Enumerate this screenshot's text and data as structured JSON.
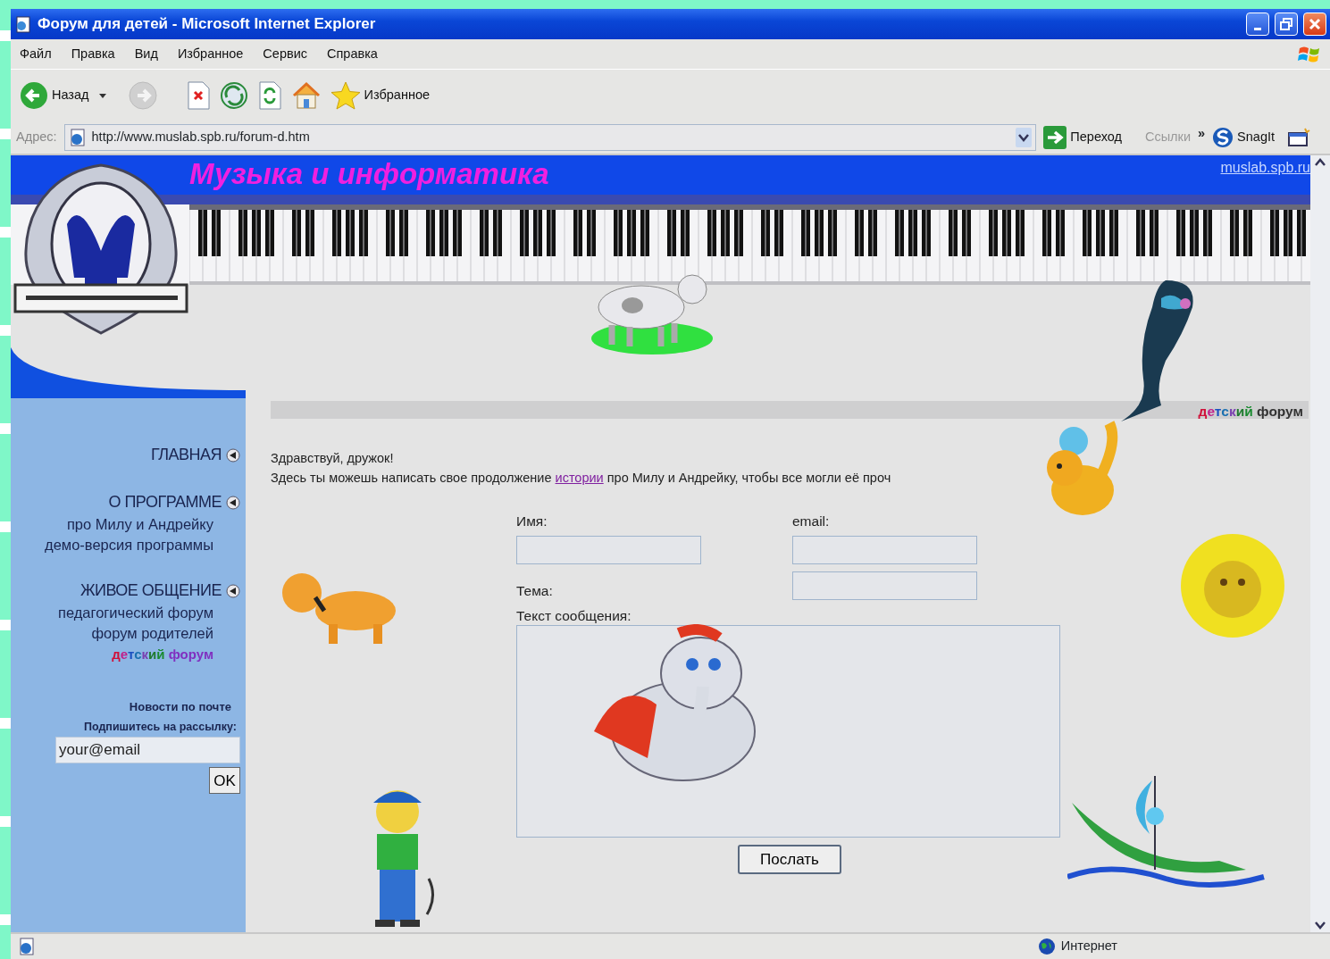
{
  "window": {
    "title": "Форум для детей - Microsoft Internet Explorer"
  },
  "menu": [
    "Файл",
    "Правка",
    "Вид",
    "Избранное",
    "Сервис",
    "Справка"
  ],
  "toolbar": {
    "back": "Назад",
    "favorites": "Избранное"
  },
  "address_bar": {
    "label": "Адрес:",
    "url": "http://www.muslab.spb.ru/forum-d.htm",
    "go": "Переход",
    "links": "Ссылки",
    "chevron": "»",
    "snagit": "SnagIt"
  },
  "page": {
    "site_title": "Музыка и информатика",
    "site_link": "muslab.spb.ru",
    "section_title": "детский форум",
    "nav": [
      {
        "heading": "ГЛАВНАЯ"
      },
      {
        "heading": "О ПРОГРАММЕ",
        "links": [
          {
            "text": "про Милу и Андрейку",
            "kind": "plain"
          },
          {
            "text": "демо-версия программы",
            "kind": "plain"
          }
        ]
      },
      {
        "heading": "ЖИВОЕ ОБЩЕНИЕ",
        "links": [
          {
            "text": "педагогический форум",
            "kind": "plain"
          },
          {
            "text": "форум родителей",
            "kind": "plain"
          },
          {
            "text": "детский форум",
            "kind": "rainbow"
          }
        ]
      }
    ],
    "newsletter": {
      "title": "Новости по почте",
      "subtitle": "Подпишитесь на рассылку:",
      "value": "your@email",
      "button": "OK"
    },
    "greeting": "Здравствуй, дружок!",
    "intro": {
      "before": "Здесь ты можешь написать свое продолжение",
      "link": "истории",
      "after": "про Милу и Андрейку, чтобы все могли её проч"
    },
    "form": {
      "name_label": "Имя:",
      "email_label": "email:",
      "subject_label": "Тема:",
      "message_label": "Текст сообщения:",
      "submit": "Послать"
    }
  },
  "status_bar": {
    "zone": "Интернет"
  }
}
